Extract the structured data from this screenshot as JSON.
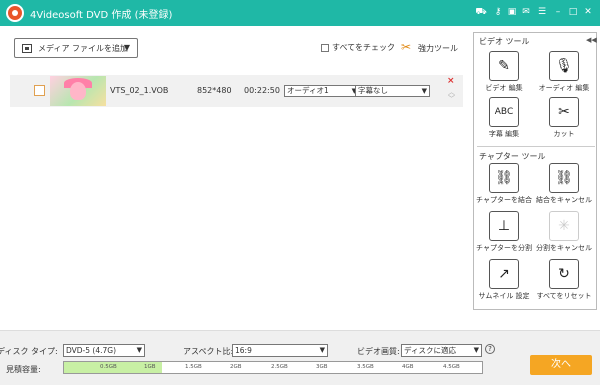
{
  "app": {
    "title": "4Videosoft DVD 作成 (未登録)"
  },
  "titlebar_icons": [
    "cart-icon",
    "key-icon",
    "save-icon",
    "chat-icon",
    "menu-icon",
    "minimize-icon",
    "maximize-icon",
    "close-icon"
  ],
  "toolbar": {
    "add_media_label": "メディア ファイルを追加",
    "check_all_label": "すべてをチェック",
    "power_tool_label": "強力ツール"
  },
  "file": {
    "name": "VTS_02_1.VOB",
    "resolution": "852*480",
    "duration": "00:22:50",
    "audio_track": "オーディオ1",
    "subtitle": "字幕なし"
  },
  "panel": {
    "video_tools_header": "ビデオ ツール",
    "chapter_tools_header": "チャプター ツール",
    "video_tools": [
      {
        "label": "ビデオ 編集",
        "icon": "magic-wand-icon"
      },
      {
        "label": "オーディオ 編集",
        "icon": "microphone-icon"
      },
      {
        "label": "字幕 編集",
        "icon": "abc-subtitle-icon"
      },
      {
        "label": "カット",
        "icon": "scissors-icon"
      }
    ],
    "chapter_tools": [
      {
        "label": "チャプターを結合",
        "icon": "link-icon"
      },
      {
        "label": "結合をキャンセル",
        "icon": "unlink-icon"
      },
      {
        "label": "チャプターを分割",
        "icon": "split-icon"
      },
      {
        "label": "分割をキャンセル",
        "icon": "cancel-split-icon"
      },
      {
        "label": "サムネイル 設定",
        "icon": "thumbnail-icon"
      },
      {
        "label": "すべてをリセット",
        "icon": "reset-icon"
      }
    ]
  },
  "bottom": {
    "disc_type_label": "ディスク タイプ:",
    "disc_type_value": "DVD-5 (4.7G)",
    "aspect_label": "アスペクト比:",
    "aspect_value": "16:9",
    "quality_label": "ビデオ画質:",
    "quality_value": "ディスクに適応",
    "capacity_label": "見積容量:",
    "capacity_ticks": [
      "0.5GB",
      "1GB",
      "1.5GB",
      "2GB",
      "2.5GB",
      "3GB",
      "3.5GB",
      "4GB",
      "4.5GB"
    ],
    "capacity_fill_gb": 1.1,
    "next_label": "次へ"
  }
}
